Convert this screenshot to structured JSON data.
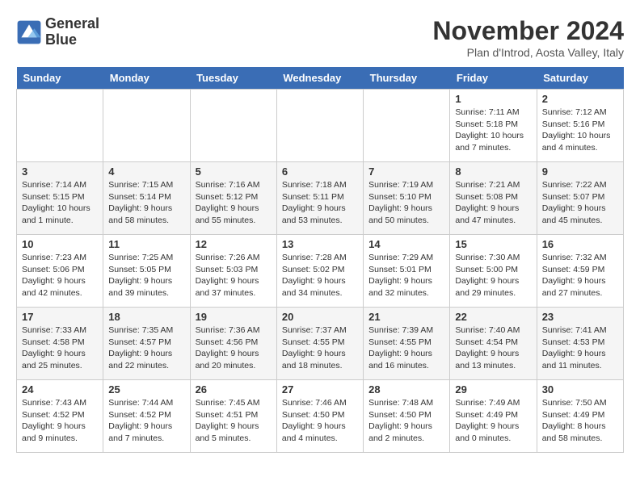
{
  "header": {
    "logo_line1": "General",
    "logo_line2": "Blue",
    "month": "November 2024",
    "location": "Plan d'Introd, Aosta Valley, Italy"
  },
  "weekdays": [
    "Sunday",
    "Monday",
    "Tuesday",
    "Wednesday",
    "Thursday",
    "Friday",
    "Saturday"
  ],
  "weeks": [
    [
      {
        "day": "",
        "info": ""
      },
      {
        "day": "",
        "info": ""
      },
      {
        "day": "",
        "info": ""
      },
      {
        "day": "",
        "info": ""
      },
      {
        "day": "",
        "info": ""
      },
      {
        "day": "1",
        "info": "Sunrise: 7:11 AM\nSunset: 5:18 PM\nDaylight: 10 hours and 7 minutes."
      },
      {
        "day": "2",
        "info": "Sunrise: 7:12 AM\nSunset: 5:16 PM\nDaylight: 10 hours and 4 minutes."
      }
    ],
    [
      {
        "day": "3",
        "info": "Sunrise: 7:14 AM\nSunset: 5:15 PM\nDaylight: 10 hours and 1 minute."
      },
      {
        "day": "4",
        "info": "Sunrise: 7:15 AM\nSunset: 5:14 PM\nDaylight: 9 hours and 58 minutes."
      },
      {
        "day": "5",
        "info": "Sunrise: 7:16 AM\nSunset: 5:12 PM\nDaylight: 9 hours and 55 minutes."
      },
      {
        "day": "6",
        "info": "Sunrise: 7:18 AM\nSunset: 5:11 PM\nDaylight: 9 hours and 53 minutes."
      },
      {
        "day": "7",
        "info": "Sunrise: 7:19 AM\nSunset: 5:10 PM\nDaylight: 9 hours and 50 minutes."
      },
      {
        "day": "8",
        "info": "Sunrise: 7:21 AM\nSunset: 5:08 PM\nDaylight: 9 hours and 47 minutes."
      },
      {
        "day": "9",
        "info": "Sunrise: 7:22 AM\nSunset: 5:07 PM\nDaylight: 9 hours and 45 minutes."
      }
    ],
    [
      {
        "day": "10",
        "info": "Sunrise: 7:23 AM\nSunset: 5:06 PM\nDaylight: 9 hours and 42 minutes."
      },
      {
        "day": "11",
        "info": "Sunrise: 7:25 AM\nSunset: 5:05 PM\nDaylight: 9 hours and 39 minutes."
      },
      {
        "day": "12",
        "info": "Sunrise: 7:26 AM\nSunset: 5:03 PM\nDaylight: 9 hours and 37 minutes."
      },
      {
        "day": "13",
        "info": "Sunrise: 7:28 AM\nSunset: 5:02 PM\nDaylight: 9 hours and 34 minutes."
      },
      {
        "day": "14",
        "info": "Sunrise: 7:29 AM\nSunset: 5:01 PM\nDaylight: 9 hours and 32 minutes."
      },
      {
        "day": "15",
        "info": "Sunrise: 7:30 AM\nSunset: 5:00 PM\nDaylight: 9 hours and 29 minutes."
      },
      {
        "day": "16",
        "info": "Sunrise: 7:32 AM\nSunset: 4:59 PM\nDaylight: 9 hours and 27 minutes."
      }
    ],
    [
      {
        "day": "17",
        "info": "Sunrise: 7:33 AM\nSunset: 4:58 PM\nDaylight: 9 hours and 25 minutes."
      },
      {
        "day": "18",
        "info": "Sunrise: 7:35 AM\nSunset: 4:57 PM\nDaylight: 9 hours and 22 minutes."
      },
      {
        "day": "19",
        "info": "Sunrise: 7:36 AM\nSunset: 4:56 PM\nDaylight: 9 hours and 20 minutes."
      },
      {
        "day": "20",
        "info": "Sunrise: 7:37 AM\nSunset: 4:55 PM\nDaylight: 9 hours and 18 minutes."
      },
      {
        "day": "21",
        "info": "Sunrise: 7:39 AM\nSunset: 4:55 PM\nDaylight: 9 hours and 16 minutes."
      },
      {
        "day": "22",
        "info": "Sunrise: 7:40 AM\nSunset: 4:54 PM\nDaylight: 9 hours and 13 minutes."
      },
      {
        "day": "23",
        "info": "Sunrise: 7:41 AM\nSunset: 4:53 PM\nDaylight: 9 hours and 11 minutes."
      }
    ],
    [
      {
        "day": "24",
        "info": "Sunrise: 7:43 AM\nSunset: 4:52 PM\nDaylight: 9 hours and 9 minutes."
      },
      {
        "day": "25",
        "info": "Sunrise: 7:44 AM\nSunset: 4:52 PM\nDaylight: 9 hours and 7 minutes."
      },
      {
        "day": "26",
        "info": "Sunrise: 7:45 AM\nSunset: 4:51 PM\nDaylight: 9 hours and 5 minutes."
      },
      {
        "day": "27",
        "info": "Sunrise: 7:46 AM\nSunset: 4:50 PM\nDaylight: 9 hours and 4 minutes."
      },
      {
        "day": "28",
        "info": "Sunrise: 7:48 AM\nSunset: 4:50 PM\nDaylight: 9 hours and 2 minutes."
      },
      {
        "day": "29",
        "info": "Sunrise: 7:49 AM\nSunset: 4:49 PM\nDaylight: 9 hours and 0 minutes."
      },
      {
        "day": "30",
        "info": "Sunrise: 7:50 AM\nSunset: 4:49 PM\nDaylight: 8 hours and 58 minutes."
      }
    ]
  ]
}
